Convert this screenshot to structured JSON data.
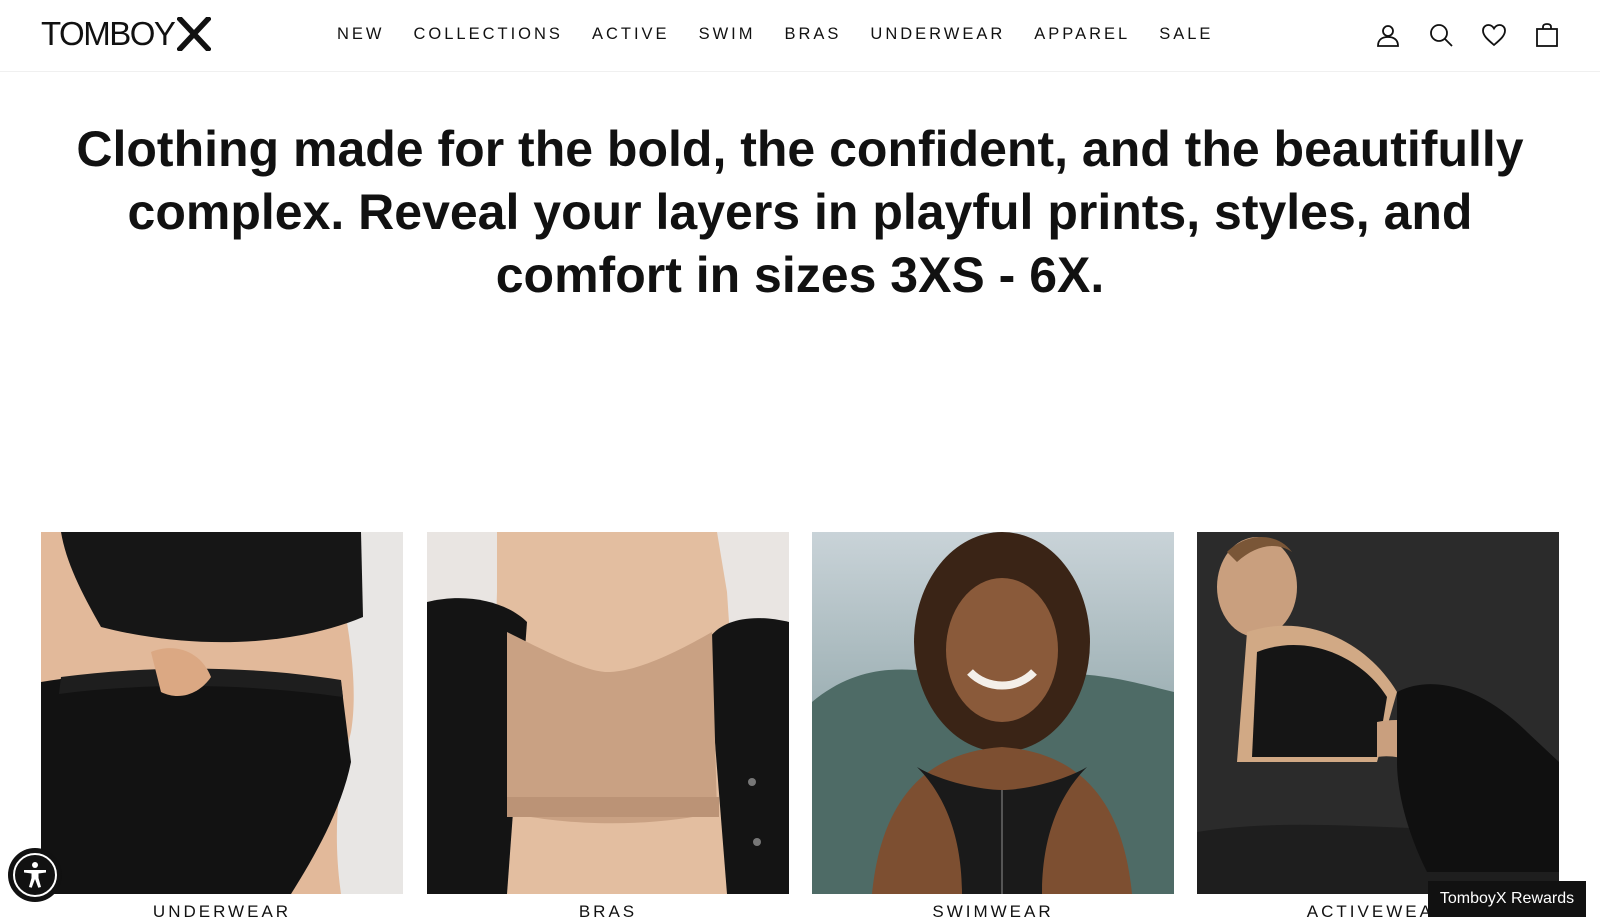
{
  "header": {
    "logo_text": "TOMBOY",
    "logo_mark": "X",
    "nav": [
      {
        "label": "NEW"
      },
      {
        "label": "COLLECTIONS"
      },
      {
        "label": "ACTIVE"
      },
      {
        "label": "SWIM"
      },
      {
        "label": "BRAS"
      },
      {
        "label": "UNDERWEAR"
      },
      {
        "label": "APPAREL"
      },
      {
        "label": "SALE"
      }
    ],
    "icons": [
      "account-icon",
      "search-icon",
      "heart-icon",
      "shopping-bag-icon"
    ]
  },
  "hero": {
    "headline": "Clothing made for the bold, the confident, and the beautifully complex. Reveal your layers in playful prints, styles, and comfort in sizes 3XS - 6X."
  },
  "categories": [
    {
      "label": "UNDERWEAR"
    },
    {
      "label": "BRAS"
    },
    {
      "label": "SWIMWEAR"
    },
    {
      "label": "ACTIVEWEAR"
    }
  ],
  "rewards": {
    "label": "TomboyX Rewards"
  },
  "accessibility": {
    "icon": "accessibility-icon"
  },
  "colors": {
    "text": "#111111",
    "background": "#ffffff",
    "button": "#111111"
  }
}
